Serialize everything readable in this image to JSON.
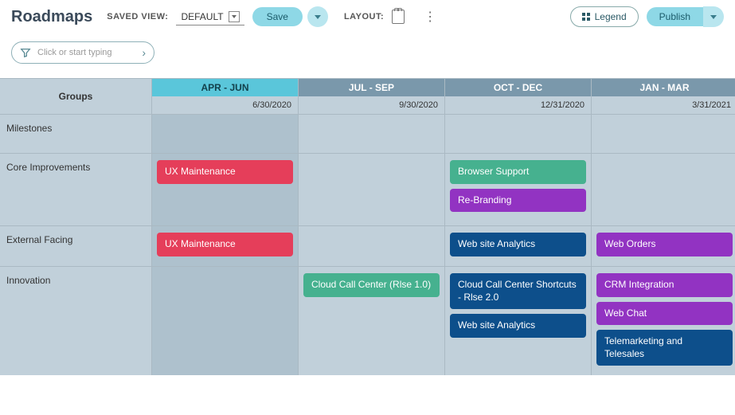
{
  "toolbar": {
    "title": "Roadmaps",
    "saved_view_label": "SAVED VIEW:",
    "saved_view_value": "DEFAULT",
    "save_label": "Save",
    "layout_label": "LAYOUT:",
    "legend_label": "Legend",
    "publish_label": "Publish"
  },
  "filter": {
    "placeholder": "Click or start typing"
  },
  "grid": {
    "groups_header": "Groups",
    "columns": [
      {
        "label": "APR - JUN",
        "date": "6/30/2020",
        "active": true
      },
      {
        "label": "JUL - SEP",
        "date": "9/30/2020",
        "active": false
      },
      {
        "label": "OCT - DEC",
        "date": "12/31/2020",
        "active": false
      },
      {
        "label": "JAN - MAR",
        "date": "3/31/2021",
        "active": false
      }
    ],
    "rows": [
      {
        "id": "milestones",
        "label": "Milestones",
        "cells": [
          [],
          [],
          [],
          []
        ]
      },
      {
        "id": "core",
        "label": "Core Improvements",
        "cells": [
          [
            {
              "text": "UX Maintenance",
              "color": "red"
            }
          ],
          [],
          [
            {
              "text": "Browser Support",
              "color": "green"
            },
            {
              "text": "Re-Branding",
              "color": "purple"
            }
          ],
          []
        ]
      },
      {
        "id": "external",
        "label": "External Facing",
        "cells": [
          [
            {
              "text": "UX Maintenance",
              "color": "red"
            }
          ],
          [],
          [
            {
              "text": "Web site Analytics",
              "color": "blue"
            }
          ],
          [
            {
              "text": "Web Orders",
              "color": "purple"
            }
          ]
        ]
      },
      {
        "id": "innovation",
        "label": "Innovation",
        "cells": [
          [],
          [
            {
              "text": "Cloud Call Center (Rlse 1.0)",
              "color": "green"
            }
          ],
          [
            {
              "text": "Cloud Call Center Shortcuts - Rlse 2.0",
              "color": "blue"
            },
            {
              "text": "Web site Analytics",
              "color": "blue"
            }
          ],
          [
            {
              "text": "CRM Integration",
              "color": "purple"
            },
            {
              "text": "Web Chat",
              "color": "purple"
            },
            {
              "text": "Telemarketing and Telesales",
              "color": "blue"
            }
          ]
        ]
      }
    ]
  },
  "colors": {
    "red": "#e53e5a",
    "green": "#46b18f",
    "purple": "#9233c2",
    "blue": "#0d4f8b"
  }
}
